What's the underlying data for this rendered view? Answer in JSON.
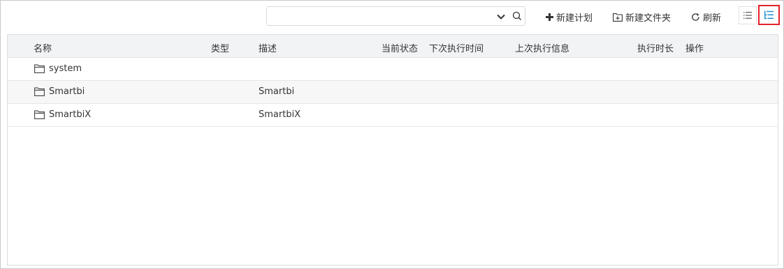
{
  "toolbar": {
    "search_placeholder": "",
    "new_plan_label": "新建计划",
    "new_folder_label": "新建文件夹",
    "refresh_label": "刷新"
  },
  "table": {
    "columns": [
      "名称",
      "类型",
      "描述",
      "当前状态",
      "下次执行时间",
      "上次执行信息",
      "执行时长",
      "操作"
    ],
    "rows": [
      {
        "name": "system",
        "type": "",
        "desc": ""
      },
      {
        "name": "Smartbi",
        "type": "",
        "desc": "Smartbi"
      },
      {
        "name": "SmartbiX",
        "type": "",
        "desc": "SmartbiX"
      }
    ]
  },
  "colors": {
    "header_bg": "#f2f3f5",
    "alt_row_bg": "#f7f7f7",
    "highlight_border": "#e2222a",
    "tree_icon": "#1a8ccf"
  }
}
